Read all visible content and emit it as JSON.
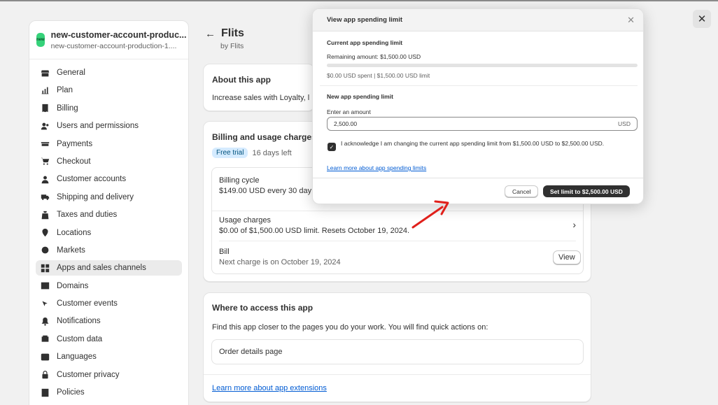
{
  "window": {
    "close_icon": "close-icon"
  },
  "store": {
    "logo_text": "new",
    "name": "new-customer-account-produc...",
    "subtitle": "new-customer-account-production-1...."
  },
  "sidebar": {
    "items": [
      {
        "label": "General",
        "icon": "store-icon"
      },
      {
        "label": "Plan",
        "icon": "plan-icon"
      },
      {
        "label": "Billing",
        "icon": "billing-icon"
      },
      {
        "label": "Users and permissions",
        "icon": "users-icon"
      },
      {
        "label": "Payments",
        "icon": "payments-icon"
      },
      {
        "label": "Checkout",
        "icon": "cart-icon"
      },
      {
        "label": "Customer accounts",
        "icon": "person-icon"
      },
      {
        "label": "Shipping and delivery",
        "icon": "truck-icon"
      },
      {
        "label": "Taxes and duties",
        "icon": "tax-icon"
      },
      {
        "label": "Locations",
        "icon": "location-icon"
      },
      {
        "label": "Markets",
        "icon": "globe-icon"
      },
      {
        "label": "Apps and sales channels",
        "icon": "apps-icon"
      },
      {
        "label": "Domains",
        "icon": "domain-icon"
      },
      {
        "label": "Customer events",
        "icon": "cursor-icon"
      },
      {
        "label": "Notifications",
        "icon": "bell-icon"
      },
      {
        "label": "Custom data",
        "icon": "data-icon"
      },
      {
        "label": "Languages",
        "icon": "language-icon"
      },
      {
        "label": "Customer privacy",
        "icon": "lock-icon"
      },
      {
        "label": "Policies",
        "icon": "policy-icon"
      }
    ],
    "active_index": 11
  },
  "app": {
    "back_arrow": "←",
    "title": "Flits",
    "by": "by Flits"
  },
  "about": {
    "title": "About this app",
    "text": "Increase sales with Loyalty, l"
  },
  "billing": {
    "title": "Billing and usage charges",
    "badge": "Free trial",
    "days_left": "16 days left",
    "cycle_title": "Billing cycle",
    "cycle_sub": "$149.00 USD every 30 day",
    "usage_title": "Usage charges",
    "usage_sub": "$0.00 of $1,500.00 USD limit. Resets October 19, 2024.",
    "bill_title": "Bill",
    "bill_sub": "Next charge is on October 19, 2024",
    "view_label": "View"
  },
  "access": {
    "title": "Where to access this app",
    "text": "Find this app closer to the pages you do your work. You will find quick actions on:",
    "item": "Order details page",
    "link": "Learn more about app extensions"
  },
  "modal": {
    "title": "View app spending limit",
    "current_title": "Current app spending limit",
    "remaining": "Remaining amount: $1,500.00 USD",
    "spent_fraction": 0.0,
    "spent_line": "$0.00 USD spent | $1,500.00 USD limit",
    "new_title": "New app spending limit",
    "input_label": "Enter an amount",
    "input_value": "2,500.00",
    "input_suffix": "USD",
    "ack_checked": true,
    "ack_text": "I acknowledge I am changing the current app spending limit from $1,500.00 USD to $2,500.00 USD.",
    "learn_link": "Learn more about app spending limits",
    "cancel_label": "Cancel",
    "set_label": "Set limit to $2,500.00 USD"
  },
  "colors": {
    "annotation_arrow": "#e0201b",
    "primary_button": "#303030",
    "link": "#005bd3"
  }
}
